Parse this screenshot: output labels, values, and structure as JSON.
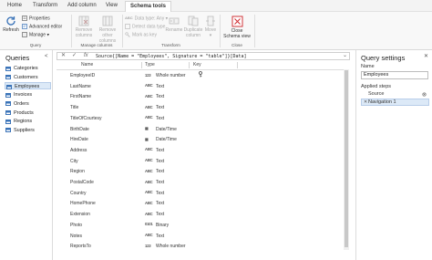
{
  "tabs": [
    "Home",
    "Transform",
    "Add column",
    "View",
    "Schema tools"
  ],
  "ribbon": {
    "refresh": "Refresh",
    "properties": "Properties",
    "advanced_editor": "Advanced editor",
    "manage": "Manage ▾",
    "query_group": "Query",
    "remove_columns": "Remove columns",
    "remove_other_columns": "Remove other columns",
    "manage_columns_group": "Manage columns",
    "data_type": "Data type: Any ▾",
    "detect_data_type": "Detect data type",
    "mark_as_key": "Mark as key",
    "rename": "Rename",
    "duplicate_column": "Duplicate column",
    "move": "Move ▾",
    "transform_group": "Transform",
    "close_schema_view": "Close Schema view",
    "close_group": "Close"
  },
  "queries": {
    "title": "Queries",
    "collapse": "<",
    "items": [
      "Categories",
      "Customers",
      "Employees",
      "Invoices",
      "Orders",
      "Products",
      "Regions",
      "Suppliers"
    ],
    "selected": "Employees"
  },
  "formula": {
    "cancel": "✕",
    "commit": "✓",
    "fx": "fx",
    "text": "Source{[Name = \"Employees\", Signature = \"table\"]}[Data]",
    "expand": "⌄"
  },
  "grid": {
    "headers": [
      "Name",
      "Type",
      "Key"
    ],
    "rows": [
      {
        "name": "EmployeeID",
        "type_icon": "123",
        "type": "Whole number",
        "key": true
      },
      {
        "name": "LastName",
        "type_icon": "ABC",
        "type": "Text",
        "key": false
      },
      {
        "name": "FirstName",
        "type_icon": "ABC",
        "type": "Text",
        "key": false
      },
      {
        "name": "Title",
        "type_icon": "ABC",
        "type": "Text",
        "key": false
      },
      {
        "name": "TitleOfCourtesy",
        "type_icon": "ABC",
        "type": "Text",
        "key": false
      },
      {
        "name": "BirthDate",
        "type_icon": "▦",
        "type": "Date/Time",
        "key": false
      },
      {
        "name": "HireDate",
        "type_icon": "▦",
        "type": "Date/Time",
        "key": false
      },
      {
        "name": "Address",
        "type_icon": "ABC",
        "type": "Text",
        "key": false
      },
      {
        "name": "City",
        "type_icon": "ABC",
        "type": "Text",
        "key": false
      },
      {
        "name": "Region",
        "type_icon": "ABC",
        "type": "Text",
        "key": false
      },
      {
        "name": "PostalCode",
        "type_icon": "ABC",
        "type": "Text",
        "key": false
      },
      {
        "name": "Country",
        "type_icon": "ABC",
        "type": "Text",
        "key": false
      },
      {
        "name": "HomePhone",
        "type_icon": "ABC",
        "type": "Text",
        "key": false
      },
      {
        "name": "Extension",
        "type_icon": "ABC",
        "type": "Text",
        "key": false
      },
      {
        "name": "Photo",
        "type_icon": "0101",
        "type": "Binary",
        "key": false
      },
      {
        "name": "Notes",
        "type_icon": "ABC",
        "type": "Text",
        "key": false
      },
      {
        "name": "ReportsTo",
        "type_icon": "123",
        "type": "Whole number",
        "key": false
      }
    ]
  },
  "settings": {
    "title": "Query settings",
    "close": "✕",
    "name_label": "Name",
    "name_value": "Employees",
    "applied_steps_label": "Applied steps",
    "steps": [
      "Source",
      "Navigation 1"
    ]
  },
  "colors": {
    "accent": "#3a73b8",
    "close_red": "#d13438",
    "selection": "#dce9f7"
  }
}
